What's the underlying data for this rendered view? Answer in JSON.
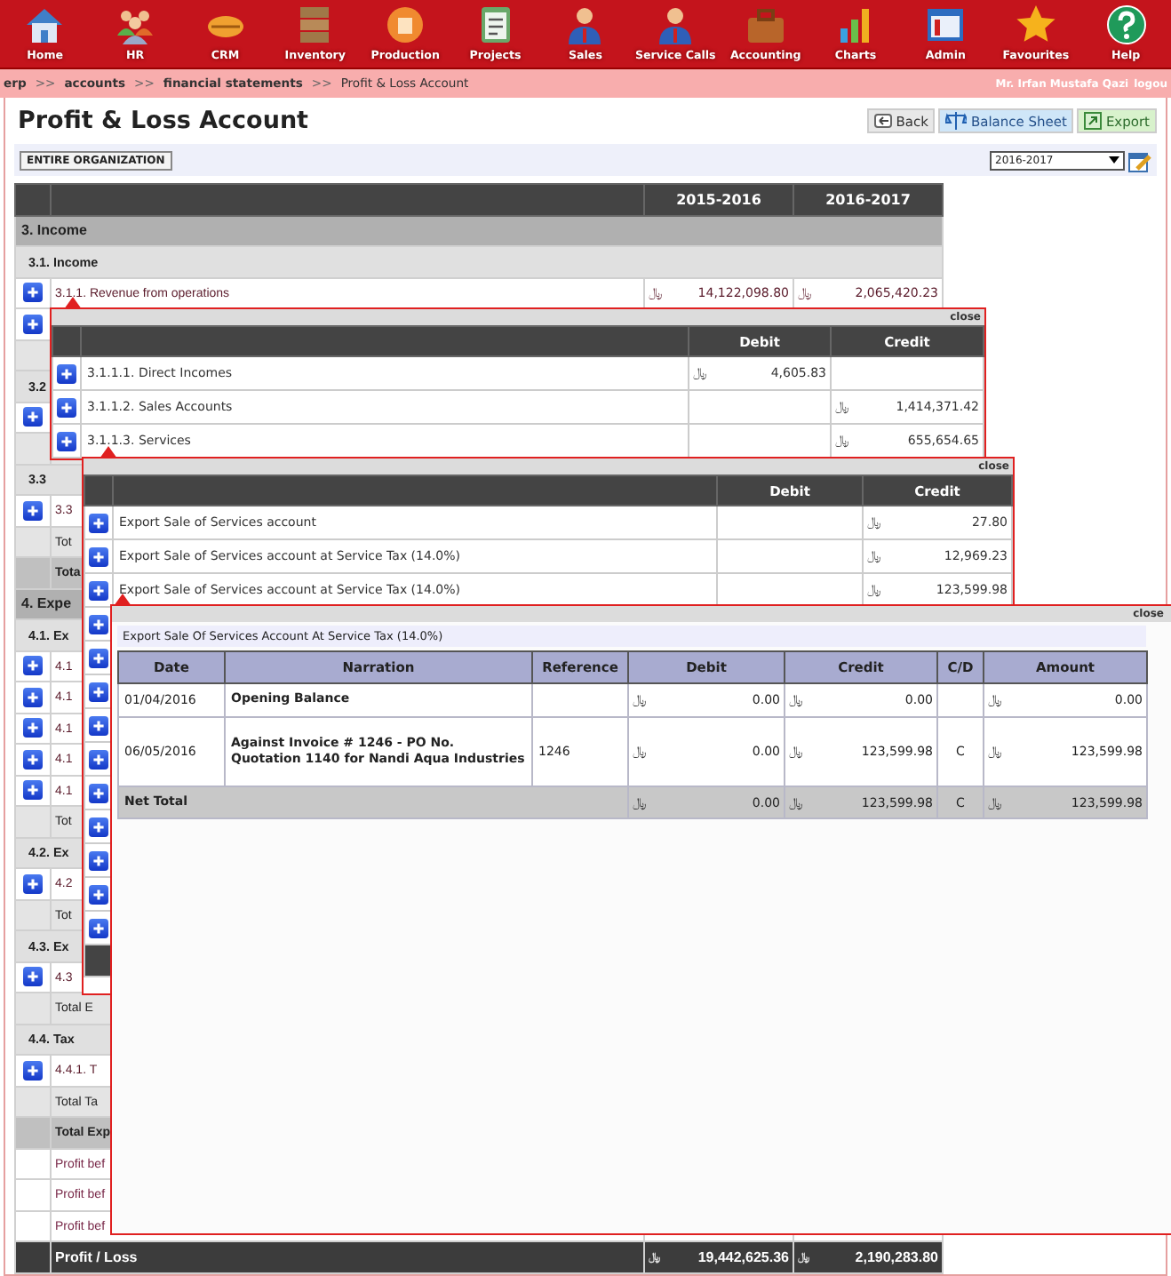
{
  "nav": [
    {
      "label": "Home"
    },
    {
      "label": "HR"
    },
    {
      "label": "CRM"
    },
    {
      "label": "Inventory"
    },
    {
      "label": "Production"
    },
    {
      "label": "Projects"
    },
    {
      "label": "Sales"
    },
    {
      "label": "Service Calls"
    },
    {
      "label": "Accounting"
    },
    {
      "label": "Charts"
    },
    {
      "label": "Admin"
    },
    {
      "label": "Favourites"
    },
    {
      "label": "Help"
    }
  ],
  "breadcrumb": {
    "items": [
      {
        "label": "erp",
        "kind": "link"
      },
      {
        "label": ">>",
        "kind": "sep"
      },
      {
        "label": "accounts",
        "kind": "link"
      },
      {
        "label": ">>",
        "kind": "sep"
      },
      {
        "label": "financial statements",
        "kind": "link"
      },
      {
        "label": ">>",
        "kind": "sep"
      },
      {
        "label": "Profit & Loss Account",
        "kind": "current"
      }
    ],
    "user": "Mr. Irfan Mustafa Qazi",
    "logout": "logou"
  },
  "page_title": "Profit & Loss Account",
  "actions": [
    {
      "label": "Back",
      "kind": "back"
    },
    {
      "label": "Balance Sheet",
      "kind": "balance"
    },
    {
      "label": "Export",
      "kind": "export"
    }
  ],
  "scope_button": "ENTIRE ORGANIZATION",
  "year_select": {
    "value": "2016-2017"
  },
  "report": {
    "columns": [
      "2015-2016",
      "2016-2017"
    ],
    "rows": [
      {
        "kind": "section",
        "label": "3. Income"
      },
      {
        "kind": "group",
        "label": "3.1. Income"
      },
      {
        "kind": "item",
        "label": "3.1.1. Revenue from operations",
        "prior": {
          "cur": "﷼",
          "amt": "14,122,098.80"
        },
        "current": {
          "cur": "﷼",
          "amt": "2,065,420.23"
        }
      },
      {
        "kind": "item"
      },
      {
        "kind": "subtotal"
      },
      {
        "kind": "group",
        "label": "3.2"
      },
      {
        "kind": "item"
      },
      {
        "kind": "subtotal"
      },
      {
        "kind": "group",
        "label": "3.3"
      },
      {
        "kind": "item",
        "label": "3.3"
      },
      {
        "kind": "subtotal",
        "label": "Tot"
      },
      {
        "kind": "total",
        "label": "Tota"
      },
      {
        "kind": "section",
        "label": "4. Expe"
      },
      {
        "kind": "group",
        "label": "4.1. Ex"
      },
      {
        "kind": "item",
        "label": "4.1"
      },
      {
        "kind": "item",
        "label": "4.1"
      },
      {
        "kind": "item",
        "label": "4.1"
      },
      {
        "kind": "item",
        "label": "4.1"
      },
      {
        "kind": "item",
        "label": "4.1"
      },
      {
        "kind": "subtotal",
        "label": "Tot"
      },
      {
        "kind": "group",
        "label": "4.2. Ex"
      },
      {
        "kind": "item",
        "label": "4.2"
      },
      {
        "kind": "subtotal",
        "label": "Tot"
      },
      {
        "kind": "group",
        "label": "4.3. Ex"
      },
      {
        "kind": "item",
        "label": "4.3"
      },
      {
        "kind": "subtotal",
        "label": "Total E"
      },
      {
        "kind": "group",
        "label": "4.4. Tax"
      },
      {
        "kind": "item",
        "label": "4.4.1. T"
      },
      {
        "kind": "subtotal",
        "label": "Total Ta"
      },
      {
        "kind": "total",
        "label": "Total Exp"
      },
      {
        "kind": "plain",
        "label": "Profit bef"
      },
      {
        "kind": "plain",
        "label": "Profit bef"
      },
      {
        "kind": "plain",
        "label": "Profit bef"
      },
      {
        "kind": "result",
        "label": "Profit / Loss",
        "prior": {
          "cur": "﷼",
          "amt": "19,442,625.36"
        },
        "current": {
          "cur": "﷼",
          "amt": "2,190,283.80"
        }
      }
    ]
  },
  "popups": [
    {
      "close": "close",
      "columns": [
        "Debit",
        "Credit"
      ],
      "rows": [
        {
          "kind": "item",
          "label": "3.1.1.1. Direct Incomes",
          "debit": {
            "cur": "﷼",
            "amt": "4,605.83"
          }
        },
        {
          "kind": "item",
          "label": "3.1.1.2. Sales Accounts",
          "credit": {
            "cur": "﷼",
            "amt": "1,414,371.42"
          }
        },
        {
          "kind": "item",
          "label": "3.1.1.3. Services",
          "credit": {
            "cur": "﷼",
            "amt": "655,654.65"
          }
        }
      ]
    },
    {
      "close": "close",
      "columns": [
        "Debit",
        "Credit"
      ],
      "rows": [
        {
          "kind": "item",
          "label": "Export Sale of Services account",
          "credit": {
            "cur": "﷼",
            "amt": "27.80"
          }
        },
        {
          "kind": "item",
          "label": "Export Sale of Services account at Service Tax (14.0%)",
          "credit": {
            "cur": "﷼",
            "amt": "12,969.23"
          }
        },
        {
          "kind": "item",
          "label": "Export Sale of Services account at Service Tax (14.0%)",
          "credit": {
            "cur": "﷼",
            "amt": "123,599.98"
          }
        },
        {
          "kind": "item"
        },
        {
          "kind": "item"
        },
        {
          "kind": "item"
        },
        {
          "kind": "item"
        },
        {
          "kind": "item"
        },
        {
          "kind": "item"
        },
        {
          "kind": "item"
        },
        {
          "kind": "item"
        },
        {
          "kind": "item"
        },
        {
          "kind": "item"
        },
        {
          "kind": "footer"
        }
      ]
    }
  ],
  "ledger": {
    "close": "close",
    "title": "Export Sale Of Services Account At Service Tax (14.0%)",
    "columns": [
      "Date",
      "Narration",
      "Reference",
      "Debit",
      "Credit",
      "C/D",
      "Amount"
    ],
    "rows": [
      {
        "date": "01/04/2016",
        "narration": "Opening Balance",
        "debit": {
          "cur": "﷼",
          "amt": "0.00"
        },
        "credit": {
          "cur": "﷼",
          "amt": "0.00"
        },
        "amount": {
          "cur": "﷼",
          "amt": "0.00"
        }
      },
      {
        "date": "06/05/2016",
        "narration": "Against Invoice # 1246 - PO No. Quotation 1140 for Nandi Aqua Industries",
        "reference": "1246",
        "debit": {
          "cur": "﷼",
          "amt": "0.00"
        },
        "credit": {
          "cur": "﷼",
          "amt": "123,599.98"
        },
        "cd": "C",
        "amount": {
          "cur": "﷼",
          "amt": "123,599.98"
        }
      }
    ],
    "total": {
      "label": "Net Total",
      "debit": {
        "cur": "﷼",
        "amt": "0.00"
      },
      "credit": {
        "cur": "﷼",
        "amt": "123,599.98"
      },
      "cd": "C",
      "amount": {
        "cur": "﷼",
        "amt": "123,599.98"
      }
    }
  }
}
